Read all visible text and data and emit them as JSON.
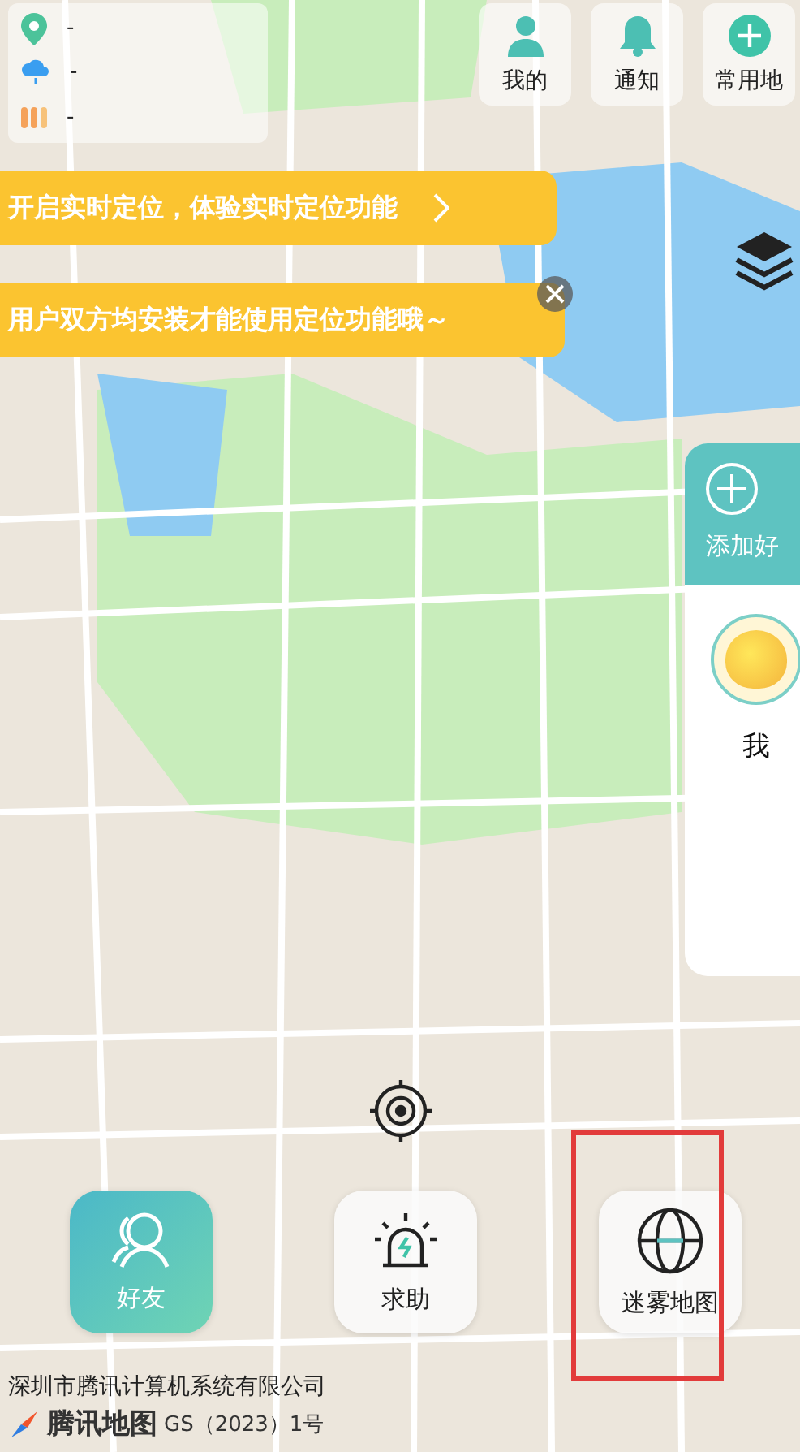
{
  "weather": [
    {
      "kind": "location",
      "value": "-"
    },
    {
      "kind": "rain",
      "value": "-"
    },
    {
      "kind": "bars",
      "value": "-"
    }
  ],
  "top_buttons": [
    {
      "kind": "person",
      "label": "我的"
    },
    {
      "kind": "bell",
      "label": "通知"
    },
    {
      "kind": "plus",
      "label": "常用地"
    }
  ],
  "banners": [
    {
      "kind": "link",
      "text": "开启实时定位，体验实时定位功能"
    },
    {
      "kind": "dismissable",
      "text": "用户双方均安装才能使用定位功能哦～"
    }
  ],
  "friends_panel": {
    "add_label": "添加好",
    "friends": [
      {
        "name": "我"
      }
    ]
  },
  "bottom_buttons": [
    {
      "kind": "friends",
      "label": "好友"
    },
    {
      "kind": "alarm",
      "label": "求助"
    },
    {
      "kind": "globe",
      "label": "迷雾地图"
    }
  ],
  "attribution": {
    "company": "深圳市腾讯计算机系统有限公司",
    "brand": "腾讯地图",
    "license": "GS（2023）1号"
  }
}
